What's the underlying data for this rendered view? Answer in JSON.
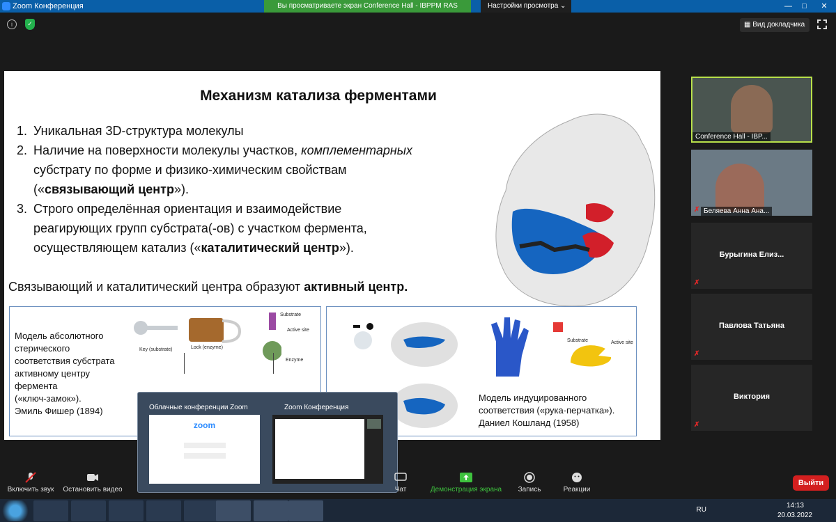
{
  "window": {
    "title": "Zoom Конференция",
    "min": "—",
    "max": "□",
    "close": "✕"
  },
  "share_banner": "Вы просматриваете экран Conference Hall - IBPPM RAS",
  "view_settings": "Настройки просмотра ⌄",
  "speaker_view": "Вид докладчика",
  "slide": {
    "title": "Механизм катализа ферментами",
    "items": [
      {
        "num": "1.",
        "lines": [
          "Уникальная 3D-структура молекулы"
        ]
      },
      {
        "num": "2.",
        "pre": "Наличие на поверхности молекулы участков, ",
        "em": "комплементарных",
        "line2": "субстрату по форме и физико-химическим свойствам",
        "l3pre": "(«",
        "l3bold": "связывающий центр",
        "l3post": "»)."
      },
      {
        "num": "3.",
        "line1": "Строго определённая ориентация и взаимодействие",
        "line2": "реагирующих групп субстрата(-ов) с участком фермента,",
        "l3pre": "осуществляющем катализ («",
        "l3bold": "каталитический центр",
        "l3post": "»)."
      }
    ],
    "summary_pre": "Связывающий и каталитический центра образуют ",
    "summary_bold": "активный центр.",
    "left_panel": {
      "text": [
        "Модель абсолютного",
        "стерического",
        "соответствия субстрата",
        "активному центру",
        "фермента",
        "(«ключ-замок»).",
        "Эмиль Фишер (1894)"
      ],
      "key_label": "Key (substrate)",
      "lock_label": "Lock (enzyme)",
      "substrate": "Substrate",
      "active_site": "Active site",
      "enzyme": "Enzyme"
    },
    "right_panel": {
      "text": [
        "Модель индуцированного",
        "соответствия («рука-перчатка»).",
        "Даниел Кошланд (1958)"
      ],
      "substrate": "Substrate",
      "active_site": "Active site"
    }
  },
  "participants": [
    {
      "name": "Conference Hall - IBP...",
      "active": true
    },
    {
      "name": "Беляева Анна Ана...",
      "muted": true
    },
    {
      "name": "Бурыгина  Елиз...",
      "muted": true
    },
    {
      "name": "Павлова Татьяна",
      "muted": true
    },
    {
      "name": "Виктория",
      "muted": true
    }
  ],
  "popup": {
    "left_title": "Облачные конференции Zoom",
    "right_title": "Zoom Конференция",
    "zoom_logo": "zoom"
  },
  "controls": {
    "audio": "Включить звук",
    "video": "Остановить видео",
    "chat": "Чат",
    "share": "Демонстрация экрана",
    "record": "Запись",
    "reactions": "Реакции",
    "leave": "Выйти"
  },
  "taskbar": {
    "lang": "RU",
    "time": "14:13",
    "date": "20.03.2022"
  }
}
